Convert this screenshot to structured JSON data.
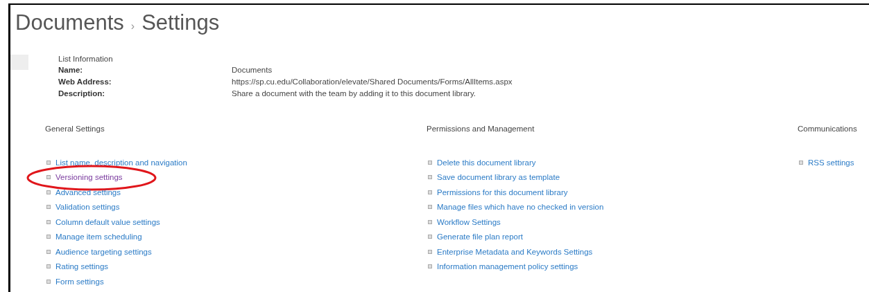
{
  "title": {
    "parent": "Documents",
    "separator": "›",
    "current": "Settings"
  },
  "list_information": {
    "heading": "List Information",
    "fields": [
      {
        "label": "Name:",
        "value": "Documents"
      },
      {
        "label": "Web Address:",
        "value": "https://sp.cu.edu/Collaboration/elevate/Shared Documents/Forms/AllItems.aspx"
      },
      {
        "label": "Description:",
        "value": "Share a document with the team by adding it to this document library."
      }
    ]
  },
  "sections": [
    {
      "heading": "General Settings",
      "links": [
        {
          "label": "List name, description and navigation",
          "visited": false
        },
        {
          "label": "Versioning settings",
          "visited": true,
          "circled": true
        },
        {
          "label": "Advanced settings",
          "visited": false
        },
        {
          "label": "Validation settings",
          "visited": false
        },
        {
          "label": "Column default value settings",
          "visited": false
        },
        {
          "label": "Manage item scheduling",
          "visited": false
        },
        {
          "label": "Audience targeting settings",
          "visited": false
        },
        {
          "label": "Rating settings",
          "visited": false
        },
        {
          "label": "Form settings",
          "visited": false
        }
      ]
    },
    {
      "heading": "Permissions and Management",
      "links": [
        {
          "label": "Delete this document library",
          "visited": false
        },
        {
          "label": "Save document library as template",
          "visited": false
        },
        {
          "label": "Permissions for this document library",
          "visited": false
        },
        {
          "label": "Manage files which have no checked in version",
          "visited": false
        },
        {
          "label": "Workflow Settings",
          "visited": false
        },
        {
          "label": "Generate file plan report",
          "visited": false
        },
        {
          "label": "Enterprise Metadata and Keywords Settings",
          "visited": false
        },
        {
          "label": "Information management policy settings",
          "visited": false
        }
      ]
    },
    {
      "heading": "Communications",
      "links": [
        {
          "label": "RSS settings",
          "visited": false
        }
      ]
    }
  ]
}
